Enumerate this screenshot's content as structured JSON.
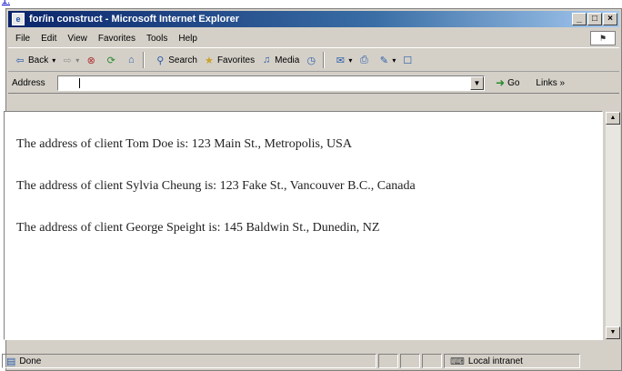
{
  "top_link": "1.",
  "window": {
    "title": "for/in construct - Microsoft Internet Explorer",
    "controls": [
      "_",
      "□",
      "×"
    ]
  },
  "menu": [
    "File",
    "Edit",
    "View",
    "Favorites",
    "Tools",
    "Help"
  ],
  "toolbar": {
    "back": "Back",
    "search": "Search",
    "favorites": "Favorites",
    "media": "Media"
  },
  "address": {
    "label": "Address",
    "value": "",
    "go": "Go",
    "links": "Links »"
  },
  "content": {
    "lines": [
      "The address of client Tom Doe is: 123 Main St., Metropolis, USA",
      "The address of client Sylvia Cheung is: 123 Fake St., Vancouver B.C., Canada",
      "The address of client George Speight is: 145 Baldwin St., Dunedin, NZ"
    ]
  },
  "status": {
    "text": "Done",
    "zone": "Local intranet"
  },
  "colors": {
    "titlebar_start": "#0a246a",
    "titlebar_end": "#a6caf0",
    "chrome": "#d4d0c8"
  }
}
